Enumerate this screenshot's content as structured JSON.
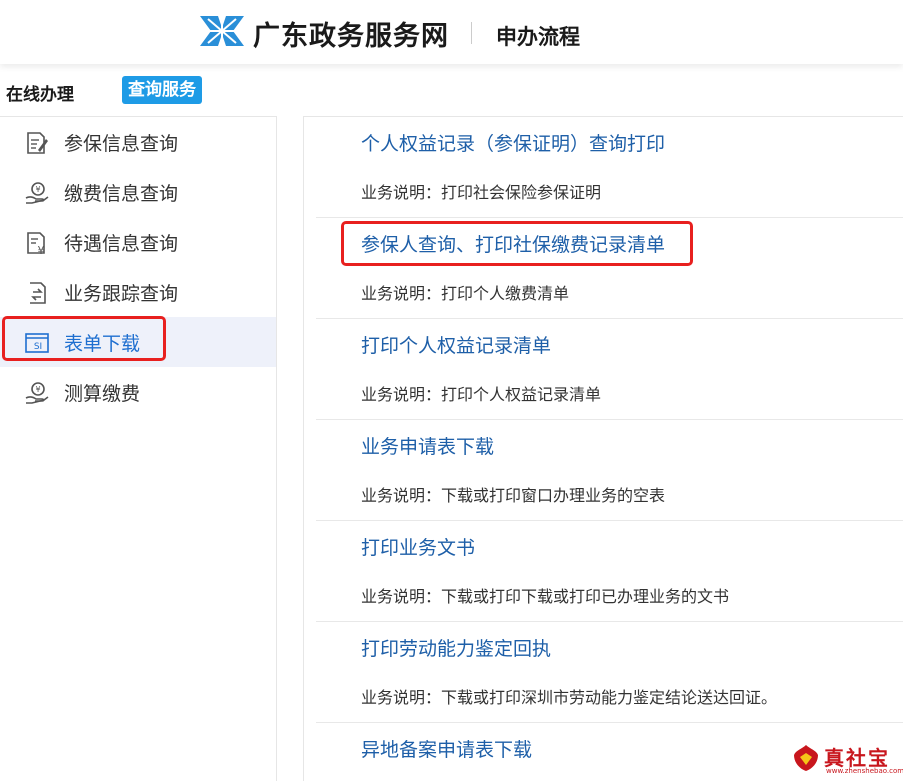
{
  "header": {
    "site_title": "广东政务服务网",
    "page_title": "申办流程"
  },
  "tabs": {
    "online": "在线办理",
    "query": "查询服务"
  },
  "sidebar": {
    "items": [
      {
        "label": "参保信息查询",
        "icon": "document-edit-icon"
      },
      {
        "label": "缴费信息查询",
        "icon": "payment-hand-icon"
      },
      {
        "label": "待遇信息查询",
        "icon": "document-yuan-icon"
      },
      {
        "label": "业务跟踪查询",
        "icon": "document-exchange-icon"
      },
      {
        "label": "表单下载",
        "icon": "form-si-icon",
        "active": true
      },
      {
        "label": "测算缴费",
        "icon": "payment-hand-icon"
      }
    ]
  },
  "content": {
    "entries": [
      {
        "title": "个人权益记录（参保证明）查询打印",
        "desc": "业务说明：打印社会保险参保证明"
      },
      {
        "title": "参保人查询、打印社保缴费记录清单",
        "desc": "业务说明：打印个人缴费清单"
      },
      {
        "title": "打印个人权益记录清单",
        "desc": "业务说明：打印个人权益记录清单"
      },
      {
        "title": "业务申请表下载",
        "desc": "业务说明：下载或打印窗口办理业务的空表"
      },
      {
        "title": "打印业务文书",
        "desc": "业务说明：下载或打印下载或打印已办理业务的文书"
      },
      {
        "title": "打印劳动能力鉴定回执",
        "desc": "业务说明：下载或打印深圳市劳动能力鉴定结论送达回证。"
      },
      {
        "title": "异地备案申请表下载",
        "desc": ""
      }
    ]
  },
  "watermark": {
    "text": "真社宝",
    "sub": "www.zhenshebao.com"
  },
  "colors": {
    "accent": "#1e9be6",
    "link": "#1e5fa8",
    "highlight": "#e8201f",
    "active_bg": "#eef1fa"
  }
}
